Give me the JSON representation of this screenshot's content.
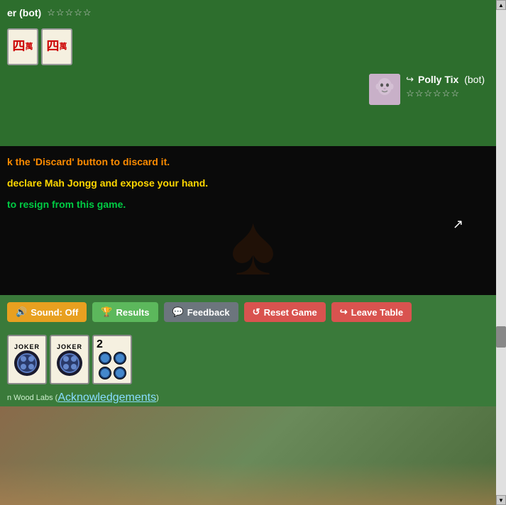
{
  "topPlayer": {
    "name": "er (bot)",
    "stars": [
      false,
      false,
      false,
      false,
      false
    ]
  },
  "topTiles": [
    {
      "character": "四\n萬",
      "label": "four-wan"
    },
    {
      "character": "四\n萬",
      "label": "four-wan-2"
    }
  ],
  "middlePlayer": {
    "name": "Polly Tix",
    "suffix": "(bot)",
    "stars": [
      false,
      false,
      false,
      false,
      false,
      false
    ]
  },
  "instructions": [
    {
      "text": "k the 'Discard' button to discard it.",
      "color": "orange"
    },
    {
      "text": "declare Mah Jongg and expose your hand.",
      "color": "yellow"
    },
    {
      "text": "to resign from this game.",
      "color": "green-text"
    }
  ],
  "buttons": {
    "sound": "Sound: Off",
    "results": "Results",
    "feedback": "Feedback",
    "reset": "Reset Game",
    "leave": "Leave Table"
  },
  "handTiles": [
    {
      "type": "joker",
      "label": "JOKER"
    },
    {
      "type": "joker",
      "label": "JOKER"
    },
    {
      "type": "number",
      "number": "2"
    }
  ],
  "footer": {
    "prefix": "n Wood Labs (",
    "linkText": "Acknowledgements",
    "suffix": ")"
  }
}
